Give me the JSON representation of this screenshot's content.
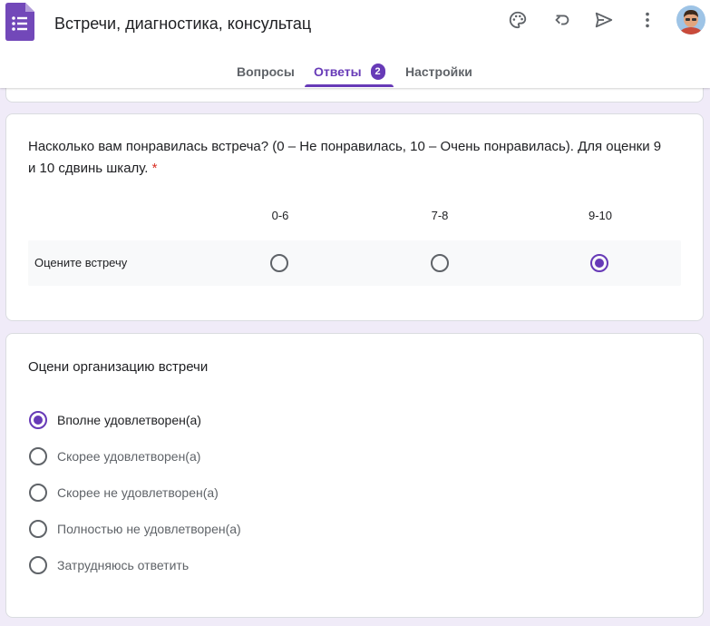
{
  "header": {
    "title": "Встречи, диагностика, консультац",
    "icons": [
      "palette-icon",
      "undo-icon",
      "send-icon",
      "more-vert-icon"
    ],
    "accent_color": "#673ab7"
  },
  "tabs": [
    {
      "label": "Вопросы",
      "active": false
    },
    {
      "label": "Ответы",
      "active": true,
      "badge": "2"
    },
    {
      "label": "Настройки",
      "active": false
    }
  ],
  "question1": {
    "text": "Насколько вам понравилась встреча? (0 – Не понравилась, 10 – Очень понравилась). Для оценки 9 и 10 сдвинь шкалу.",
    "required_mark": "*",
    "columns": [
      "0-6",
      "7-8",
      "9-10"
    ],
    "rows": [
      {
        "label": "Оцените встречу",
        "selected_column": "9-10"
      }
    ]
  },
  "question2": {
    "text": "Оцени организацию встречи",
    "options": [
      {
        "label": "Вполне удовлетворен(а)",
        "selected": true
      },
      {
        "label": "Скорее удовлетворен(а)",
        "selected": false
      },
      {
        "label": "Скорее не удовлетворен(а)",
        "selected": false
      },
      {
        "label": "Полностью не удовлетворен(а)",
        "selected": false
      },
      {
        "label": "Затрудняюсь ответить",
        "selected": false
      }
    ]
  }
}
